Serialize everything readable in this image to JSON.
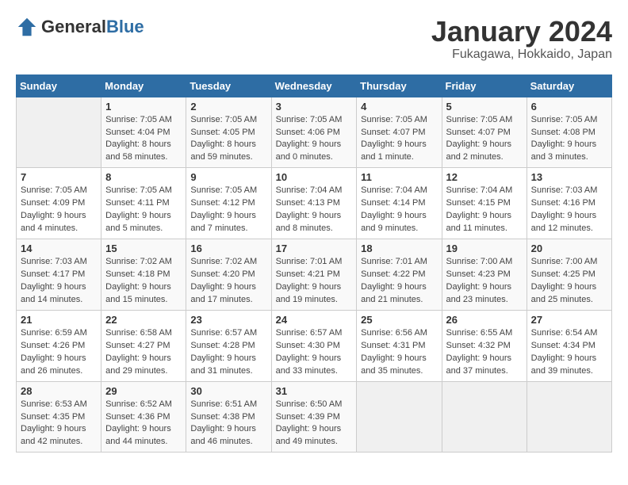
{
  "header": {
    "logo_general": "General",
    "logo_blue": "Blue",
    "month_title": "January 2024",
    "location": "Fukagawa, Hokkaido, Japan"
  },
  "calendar": {
    "days_of_week": [
      "Sunday",
      "Monday",
      "Tuesday",
      "Wednesday",
      "Thursday",
      "Friday",
      "Saturday"
    ],
    "weeks": [
      [
        {
          "day": "",
          "info": ""
        },
        {
          "day": "1",
          "info": "Sunrise: 7:05 AM\nSunset: 4:04 PM\nDaylight: 8 hours\nand 58 minutes."
        },
        {
          "day": "2",
          "info": "Sunrise: 7:05 AM\nSunset: 4:05 PM\nDaylight: 8 hours\nand 59 minutes."
        },
        {
          "day": "3",
          "info": "Sunrise: 7:05 AM\nSunset: 4:06 PM\nDaylight: 9 hours\nand 0 minutes."
        },
        {
          "day": "4",
          "info": "Sunrise: 7:05 AM\nSunset: 4:07 PM\nDaylight: 9 hours\nand 1 minute."
        },
        {
          "day": "5",
          "info": "Sunrise: 7:05 AM\nSunset: 4:07 PM\nDaylight: 9 hours\nand 2 minutes."
        },
        {
          "day": "6",
          "info": "Sunrise: 7:05 AM\nSunset: 4:08 PM\nDaylight: 9 hours\nand 3 minutes."
        }
      ],
      [
        {
          "day": "7",
          "info": "Sunrise: 7:05 AM\nSunset: 4:09 PM\nDaylight: 9 hours\nand 4 minutes."
        },
        {
          "day": "8",
          "info": "Sunrise: 7:05 AM\nSunset: 4:11 PM\nDaylight: 9 hours\nand 5 minutes."
        },
        {
          "day": "9",
          "info": "Sunrise: 7:05 AM\nSunset: 4:12 PM\nDaylight: 9 hours\nand 7 minutes."
        },
        {
          "day": "10",
          "info": "Sunrise: 7:04 AM\nSunset: 4:13 PM\nDaylight: 9 hours\nand 8 minutes."
        },
        {
          "day": "11",
          "info": "Sunrise: 7:04 AM\nSunset: 4:14 PM\nDaylight: 9 hours\nand 9 minutes."
        },
        {
          "day": "12",
          "info": "Sunrise: 7:04 AM\nSunset: 4:15 PM\nDaylight: 9 hours\nand 11 minutes."
        },
        {
          "day": "13",
          "info": "Sunrise: 7:03 AM\nSunset: 4:16 PM\nDaylight: 9 hours\nand 12 minutes."
        }
      ],
      [
        {
          "day": "14",
          "info": "Sunrise: 7:03 AM\nSunset: 4:17 PM\nDaylight: 9 hours\nand 14 minutes."
        },
        {
          "day": "15",
          "info": "Sunrise: 7:02 AM\nSunset: 4:18 PM\nDaylight: 9 hours\nand 15 minutes."
        },
        {
          "day": "16",
          "info": "Sunrise: 7:02 AM\nSunset: 4:20 PM\nDaylight: 9 hours\nand 17 minutes."
        },
        {
          "day": "17",
          "info": "Sunrise: 7:01 AM\nSunset: 4:21 PM\nDaylight: 9 hours\nand 19 minutes."
        },
        {
          "day": "18",
          "info": "Sunrise: 7:01 AM\nSunset: 4:22 PM\nDaylight: 9 hours\nand 21 minutes."
        },
        {
          "day": "19",
          "info": "Sunrise: 7:00 AM\nSunset: 4:23 PM\nDaylight: 9 hours\nand 23 minutes."
        },
        {
          "day": "20",
          "info": "Sunrise: 7:00 AM\nSunset: 4:25 PM\nDaylight: 9 hours\nand 25 minutes."
        }
      ],
      [
        {
          "day": "21",
          "info": "Sunrise: 6:59 AM\nSunset: 4:26 PM\nDaylight: 9 hours\nand 26 minutes."
        },
        {
          "day": "22",
          "info": "Sunrise: 6:58 AM\nSunset: 4:27 PM\nDaylight: 9 hours\nand 29 minutes."
        },
        {
          "day": "23",
          "info": "Sunrise: 6:57 AM\nSunset: 4:28 PM\nDaylight: 9 hours\nand 31 minutes."
        },
        {
          "day": "24",
          "info": "Sunrise: 6:57 AM\nSunset: 4:30 PM\nDaylight: 9 hours\nand 33 minutes."
        },
        {
          "day": "25",
          "info": "Sunrise: 6:56 AM\nSunset: 4:31 PM\nDaylight: 9 hours\nand 35 minutes."
        },
        {
          "day": "26",
          "info": "Sunrise: 6:55 AM\nSunset: 4:32 PM\nDaylight: 9 hours\nand 37 minutes."
        },
        {
          "day": "27",
          "info": "Sunrise: 6:54 AM\nSunset: 4:34 PM\nDaylight: 9 hours\nand 39 minutes."
        }
      ],
      [
        {
          "day": "28",
          "info": "Sunrise: 6:53 AM\nSunset: 4:35 PM\nDaylight: 9 hours\nand 42 minutes."
        },
        {
          "day": "29",
          "info": "Sunrise: 6:52 AM\nSunset: 4:36 PM\nDaylight: 9 hours\nand 44 minutes."
        },
        {
          "day": "30",
          "info": "Sunrise: 6:51 AM\nSunset: 4:38 PM\nDaylight: 9 hours\nand 46 minutes."
        },
        {
          "day": "31",
          "info": "Sunrise: 6:50 AM\nSunset: 4:39 PM\nDaylight: 9 hours\nand 49 minutes."
        },
        {
          "day": "",
          "info": ""
        },
        {
          "day": "",
          "info": ""
        },
        {
          "day": "",
          "info": ""
        }
      ]
    ]
  }
}
